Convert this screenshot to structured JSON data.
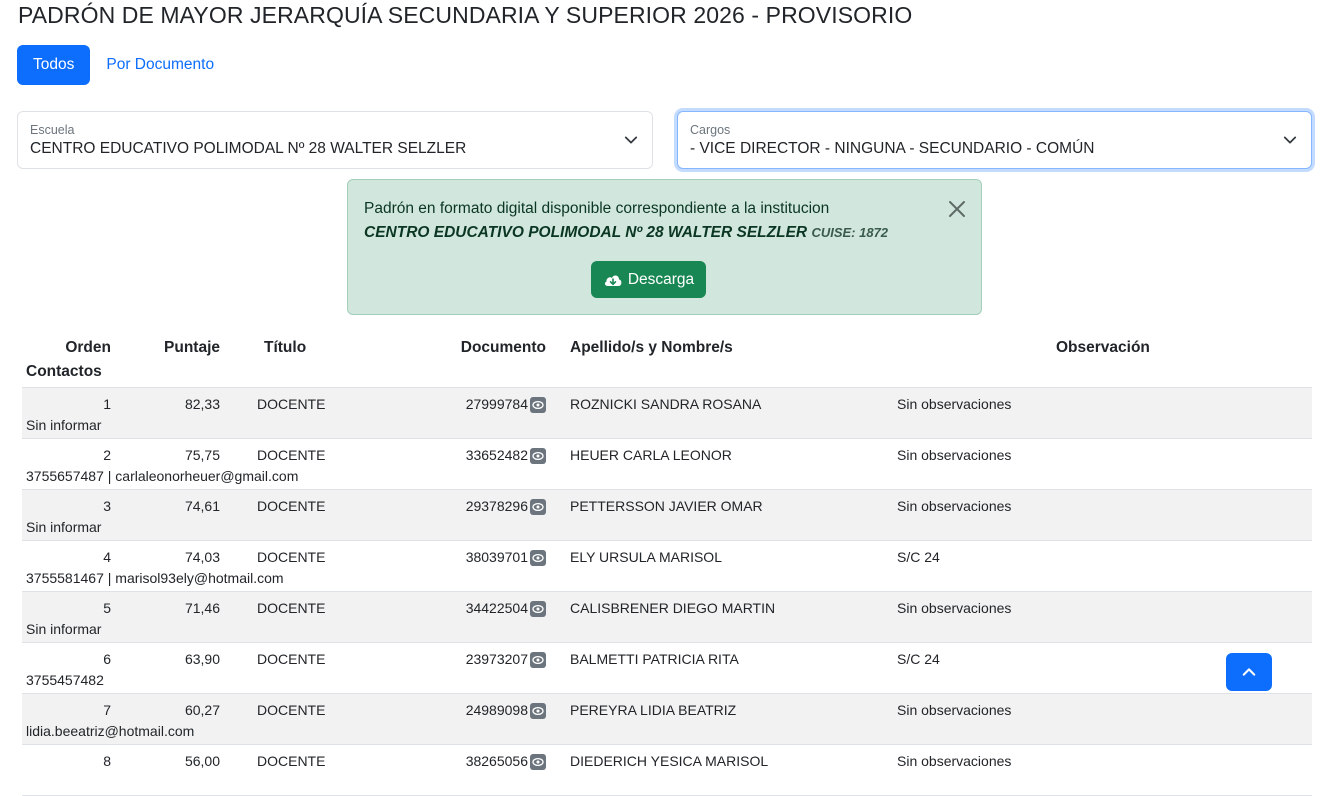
{
  "page_title": "PADRÓN DE MAYOR JERARQUÍA SECUNDARIA Y SUPERIOR 2026 - PROVISORIO",
  "tabs": [
    {
      "label": "Todos",
      "active": true
    },
    {
      "label": "Por Documento",
      "active": false
    }
  ],
  "escuela": {
    "label": "Escuela",
    "value": "CENTRO EDUCATIVO POLIMODAL Nº 28 WALTER SELZLER"
  },
  "cargos": {
    "label": "Cargos",
    "value": "- VICE DIRECTOR - NINGUNA - SECUNDARIO - COMÚN"
  },
  "alert": {
    "text": "Padrón en formato digital disponible correspondiente a la institucion",
    "school": "CENTRO EDUCATIVO POLIMODAL Nº 28 WALTER SELZLER",
    "cuise": "CUISE: 1872",
    "download_label": "Descarga"
  },
  "table": {
    "headers": {
      "orden": "Orden",
      "puntaje": "Puntaje",
      "titulo": "Título",
      "documento": "Documento",
      "nombre": "Apellido/s y Nombre/s",
      "observacion": "Observación",
      "contactos": "Contactos"
    },
    "rows": [
      {
        "orden": "1",
        "puntaje": "82,33",
        "titulo": "DOCENTE",
        "documento": "27999784",
        "nombre": "ROZNICKI SANDRA ROSANA",
        "observacion": "Sin observaciones",
        "contactos": "Sin informar"
      },
      {
        "orden": "2",
        "puntaje": "75,75",
        "titulo": "DOCENTE",
        "documento": "33652482",
        "nombre": "HEUER CARLA LEONOR",
        "observacion": "Sin observaciones",
        "contactos": "3755657487 | carlaleonorheuer@gmail.com"
      },
      {
        "orden": "3",
        "puntaje": "74,61",
        "titulo": "DOCENTE",
        "documento": "29378296",
        "nombre": "PETTERSSON JAVIER OMAR",
        "observacion": "Sin observaciones",
        "contactos": "Sin informar"
      },
      {
        "orden": "4",
        "puntaje": "74,03",
        "titulo": "DOCENTE",
        "documento": "38039701",
        "nombre": "ELY URSULA MARISOL",
        "observacion": "S/C 24",
        "contactos": "3755581467 | marisol93ely@hotmail.com"
      },
      {
        "orden": "5",
        "puntaje": "71,46",
        "titulo": "DOCENTE",
        "documento": "34422504",
        "nombre": "CALISBRENER DIEGO MARTIN",
        "observacion": "Sin observaciones",
        "contactos": "Sin informar"
      },
      {
        "orden": "6",
        "puntaje": "63,90",
        "titulo": "DOCENTE",
        "documento": "23973207",
        "nombre": "BALMETTI PATRICIA RITA",
        "observacion": "S/C 24",
        "contactos": "3755457482"
      },
      {
        "orden": "7",
        "puntaje": "60,27",
        "titulo": "DOCENTE",
        "documento": "24989098",
        "nombre": "PEREYRA LIDIA BEATRIZ",
        "observacion": "Sin observaciones",
        "contactos": "lidia.beeatriz@hotmail.com"
      },
      {
        "orden": "8",
        "puntaje": "56,00",
        "titulo": "DOCENTE",
        "documento": "38265056",
        "nombre": "DIEDERICH YESICA MARISOL",
        "observacion": "Sin observaciones",
        "contactos": ""
      }
    ]
  },
  "colors": {
    "primary": "#0d6efd",
    "success": "#198754",
    "alert_bg": "#d1e7dd"
  },
  "icons": {
    "select_chevron": "chevron-down-icon",
    "alert_close": "close-icon",
    "download": "cloud-download-icon",
    "view_doc": "eye-icon",
    "scroll_top": "chevron-up-icon"
  }
}
